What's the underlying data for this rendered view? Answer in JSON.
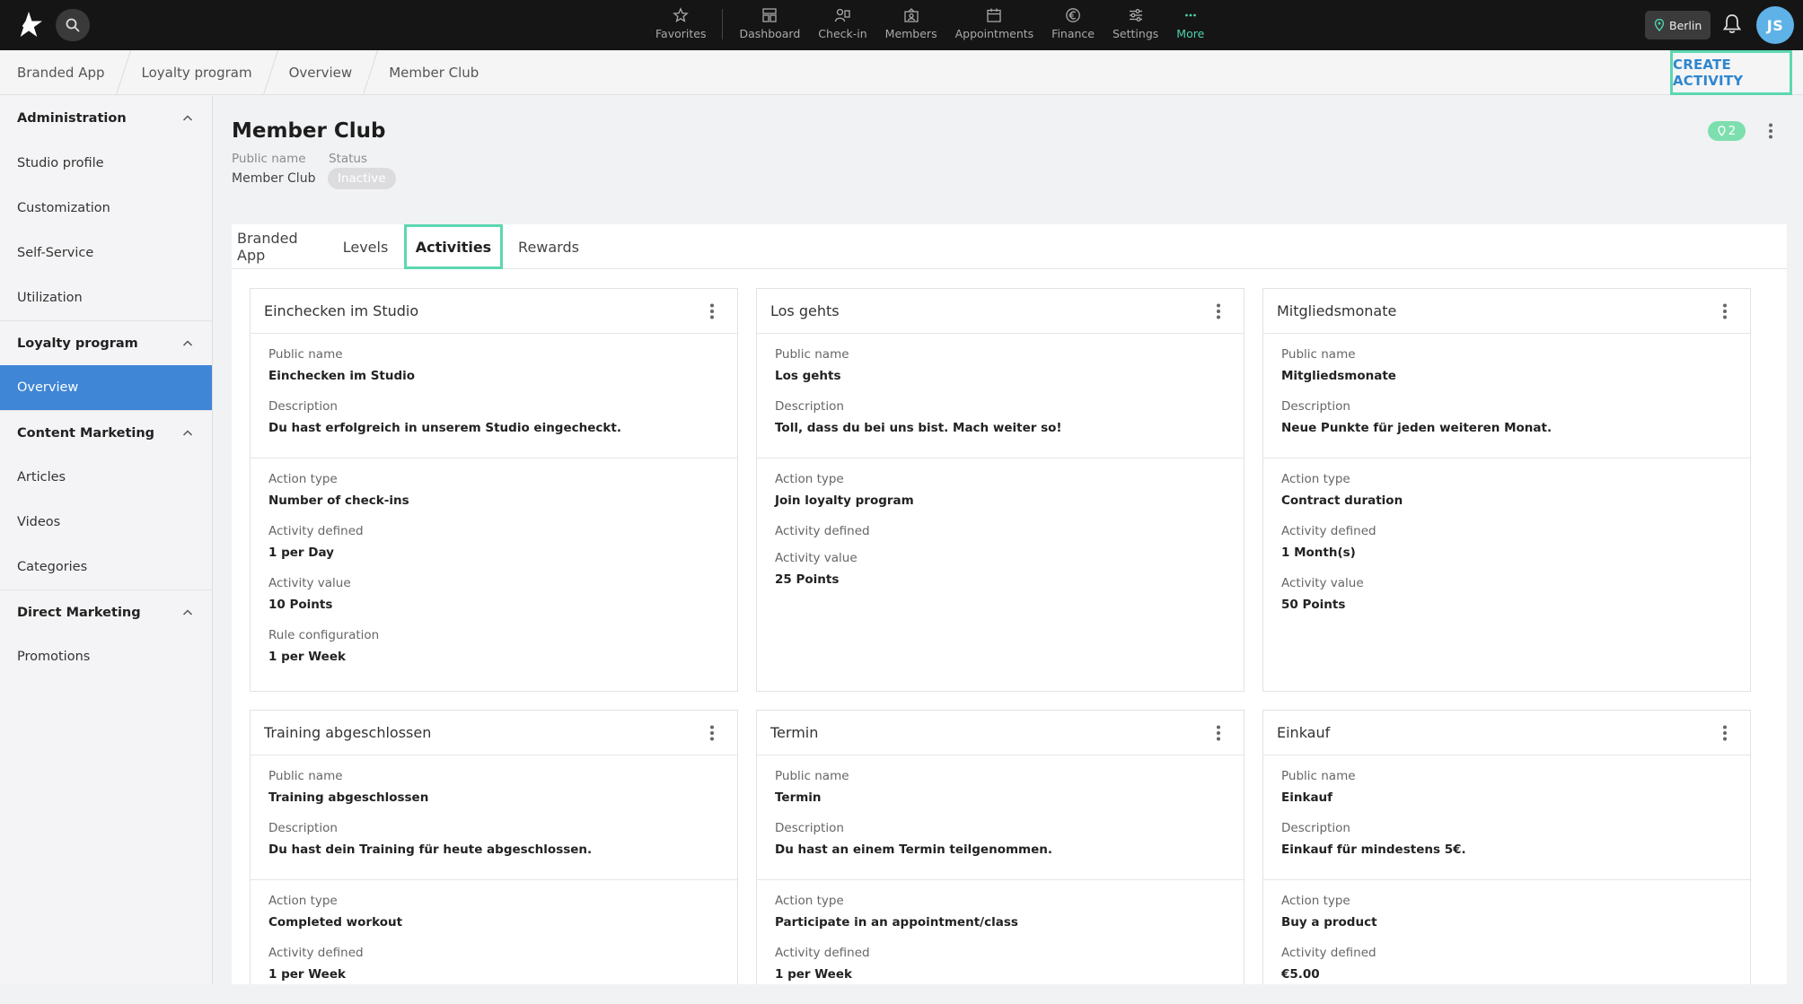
{
  "topnav": {
    "items": [
      {
        "label": "Favorites",
        "icon": "star-icon"
      },
      {
        "label": "Dashboard",
        "icon": "dashboard-icon"
      },
      {
        "label": "Check-in",
        "icon": "check-in-icon"
      },
      {
        "label": "Members",
        "icon": "members-icon"
      },
      {
        "label": "Appointments",
        "icon": "calendar-icon"
      },
      {
        "label": "Finance",
        "icon": "euro-icon"
      },
      {
        "label": "Settings",
        "icon": "sliders-icon"
      },
      {
        "label": "More",
        "icon": "more-dots-icon"
      }
    ],
    "location": "Berlin",
    "avatar_initials": "JS",
    "accent": "#4fd1ad"
  },
  "breadcrumb": [
    "Branded App",
    "Loyalty program",
    "Overview",
    "Member Club"
  ],
  "create_button": "CREATE ACTIVITY",
  "sidebar": {
    "sections": [
      {
        "title": "Administration",
        "items": [
          "Studio profile",
          "Customization",
          "Self-Service",
          "Utilization"
        ]
      },
      {
        "title": "Loyalty program",
        "items": [
          "Overview"
        ]
      },
      {
        "title": "Content Marketing",
        "items": [
          "Articles",
          "Videos",
          "Categories"
        ]
      },
      {
        "title": "Direct Marketing",
        "items": [
          "Promotions"
        ]
      }
    ],
    "active_item": "Overview",
    "active_color": "#3f86d6"
  },
  "page": {
    "title": "Member Club",
    "public_name_label": "Public name",
    "public_name_value": "Member Club",
    "status_label": "Status",
    "status_value": "Inactive",
    "pin_count": "2"
  },
  "tabs": [
    "Branded App",
    "Levels",
    "Activities",
    "Rewards"
  ],
  "active_tab": "Activities",
  "labels": {
    "public_name": "Public name",
    "description": "Description",
    "action_type": "Action type",
    "activity_defined": "Activity defined",
    "activity_value": "Activity value",
    "rule_configuration": "Rule configuration"
  },
  "activities": [
    {
      "title": "Einchecken im Studio",
      "public_name": "Einchecken im Studio",
      "description": "Du hast erfolgreich in unserem Studio eingecheckt.",
      "action_type": "Number of check-ins",
      "activity_defined": "1 per Day",
      "activity_value": "10 Points",
      "rule_configuration": "1 per Week"
    },
    {
      "title": "Los gehts",
      "public_name": "Los gehts",
      "description": "Toll, dass du bei uns bist. Mach weiter so!",
      "action_type": "Join loyalty program",
      "activity_defined": "",
      "activity_value": "25 Points"
    },
    {
      "title": "Mitgliedsmonate",
      "public_name": "Mitgliedsmonate",
      "description": "Neue Punkte für jeden weiteren Monat.",
      "action_type": "Contract duration",
      "activity_defined": "1 Month(s)",
      "activity_value": "50 Points"
    },
    {
      "title": "Training abgeschlossen",
      "public_name": "Training abgeschlossen",
      "description": "Du hast dein Training für heute abgeschlossen.",
      "action_type": "Completed workout",
      "activity_defined": "1 per Week"
    },
    {
      "title": "Termin",
      "public_name": "Termin",
      "description": "Du hast an einem Termin teilgenommen.",
      "action_type": "Participate in an appointment/class",
      "activity_defined": "1 per Week"
    },
    {
      "title": "Einkauf",
      "public_name": "Einkauf",
      "description": "Einkauf für mindestens 5€.",
      "action_type": "Buy a product",
      "activity_defined": "€5.00"
    }
  ]
}
